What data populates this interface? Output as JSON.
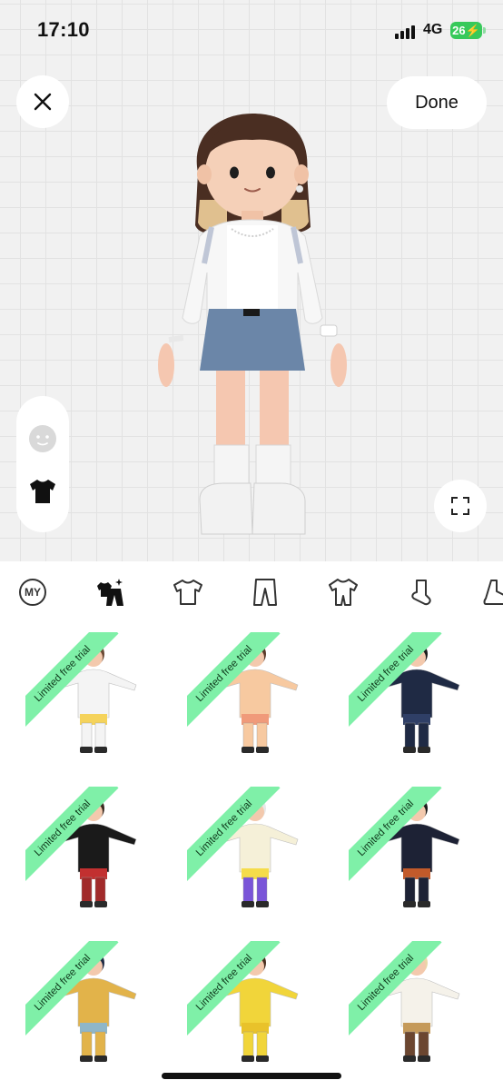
{
  "status_bar": {
    "time": "17:10",
    "network": "4G",
    "battery": "26"
  },
  "header": {
    "done_label": "Done"
  },
  "side_panel": {
    "items": [
      "face-icon",
      "shirt-icon"
    ]
  },
  "categories": {
    "my_label": "MY",
    "items": [
      "my-icon",
      "outfit-icon",
      "tshirt-icon",
      "pants-icon",
      "jumpsuit-icon",
      "sock-icon",
      "shoe-icon"
    ],
    "selected": "outfit-icon"
  },
  "outfits": {
    "ribbon_text": "Limited free trial",
    "items": [
      {
        "ribbon": "Limited free trial",
        "top": "#f4f4f4",
        "bottom": "#f4f4f4",
        "hair": "#6b4a35",
        "accent": "#f5d35b"
      },
      {
        "ribbon": "Limited free trial",
        "top": "#f7c9a0",
        "bottom": "#f7c9a0",
        "hair": "#5b3b2a",
        "accent": "#f09a7a"
      },
      {
        "ribbon": "Limited free trial",
        "top": "#1f2a44",
        "bottom": "#1f2a44",
        "hair": "#1b1b1b",
        "accent": "#2f3f66"
      },
      {
        "ribbon": "Limited free trial",
        "top": "#1a1a1a",
        "bottom": "#a12a2a",
        "hair": "#3a2a20",
        "accent": "#c23030"
      },
      {
        "ribbon": "Limited free trial",
        "top": "#f5f0d8",
        "bottom": "#7a55d8",
        "hair": "#e8e8e8",
        "accent": "#f5dc4a"
      },
      {
        "ribbon": "Limited free trial",
        "top": "#1d2235",
        "bottom": "#1d2235",
        "hair": "#1a1a1a",
        "accent": "#c25a2a"
      },
      {
        "ribbon": "Limited free trial",
        "top": "#e2b34a",
        "bottom": "#e2b34a",
        "hair": "#1f2a44",
        "accent": "#8fb6c8"
      },
      {
        "ribbon": "Limited free trial",
        "top": "#f1d53a",
        "bottom": "#f1d53a",
        "hair": "#4a3020",
        "accent": "#e9c22a"
      },
      {
        "ribbon": "Limited free trial",
        "top": "#f5f2ea",
        "bottom": "#6b4630",
        "hair": "#e9d7a6",
        "accent": "#c59a5a"
      }
    ]
  },
  "colors": {
    "accent_green": "#7ff0a8",
    "battery_green": "#37c95a",
    "background": "#f1f1f1"
  }
}
